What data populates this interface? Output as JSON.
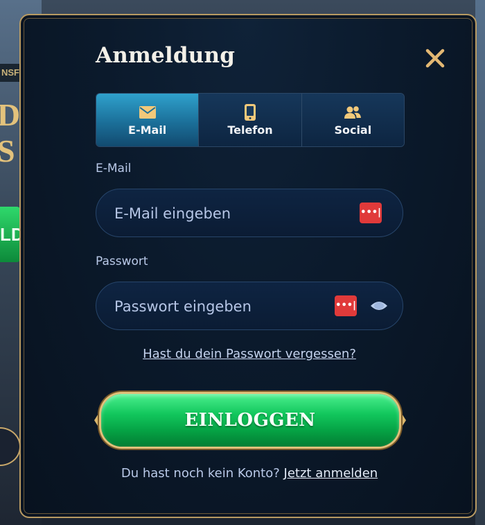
{
  "background": {
    "side_tag": "NSF",
    "side_big_text": "D E\nS",
    "side_button_text": "LD"
  },
  "dialog": {
    "title": "Anmeldung",
    "close_icon": "close-icon",
    "accent_color": "#e3b873"
  },
  "tabs": [
    {
      "label": "E-Mail",
      "icon": "envelope-icon",
      "active": true
    },
    {
      "label": "Telefon",
      "icon": "phone-icon",
      "active": false
    },
    {
      "label": "Social",
      "icon": "users-icon",
      "active": false
    }
  ],
  "form": {
    "email_label": "E-Mail",
    "email_placeholder": "E-Mail eingeben",
    "email_value": "",
    "password_label": "Passwort",
    "password_placeholder": "Passwort eingeben",
    "password_value": "",
    "password_manager_icon": "password-manager-icon",
    "password_manager_glyph": "•••|",
    "visibility_icon": "eye-icon",
    "forgot_link": "Hast du dein Passwort vergessen?",
    "login_button": "EINLOGGEN",
    "signup_prompt": "Du hast noch kein Konto?",
    "signup_link": "Jetzt anmelden"
  },
  "colors": {
    "tab_active": "#2fa1cc",
    "login_green": "#12c75d",
    "gold_border": "#b89a62"
  }
}
